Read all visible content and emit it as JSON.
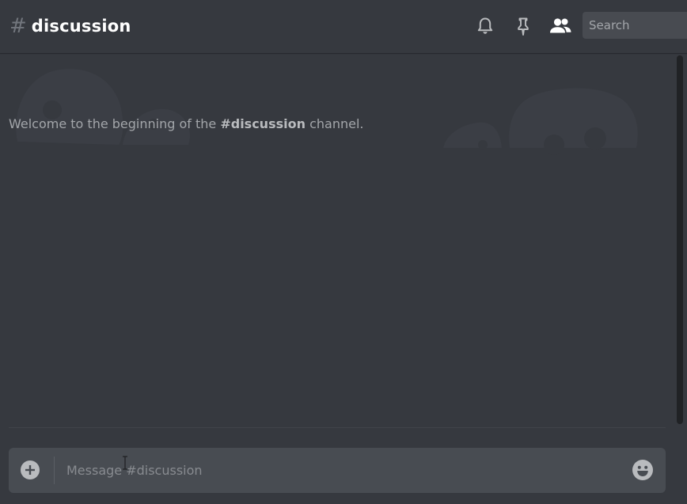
{
  "header": {
    "hash": "#",
    "channel_name": "discussion",
    "search_placeholder": "Search"
  },
  "icons": {
    "bell": "bell-icon",
    "pin": "pin-icon",
    "members": "members-icon",
    "upload": "plus-circle-icon",
    "emoji": "emoji-icon"
  },
  "welcome": {
    "prefix": "Welcome to the beginning of the ",
    "channel": "#discussion",
    "suffix": " channel."
  },
  "composer": {
    "placeholder": "Message #discussion"
  },
  "colors": {
    "background": "#36393f",
    "header_title": "#ffffff",
    "composer_bg": "#484c52",
    "muted_text": "#a3a6aa"
  }
}
